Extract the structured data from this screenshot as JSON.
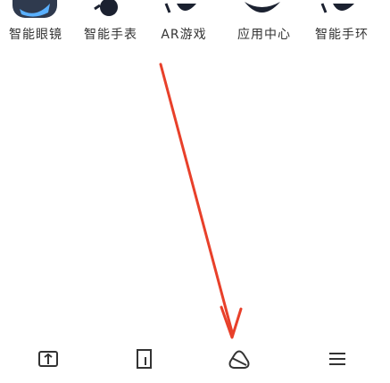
{
  "apps": [
    {
      "label": "智能眼镜",
      "icon": "wing-logo-icon"
    },
    {
      "label": "智能手表",
      "icon": "headset-icon"
    },
    {
      "label": "AR游戏",
      "icon": "ar-game-icon"
    },
    {
      "label": "应用中心",
      "icon": "bird-icon"
    },
    {
      "label": "智能手环",
      "icon": "band-icon"
    }
  ],
  "nav": [
    {
      "icon": "book-icon"
    },
    {
      "icon": "square-tab-icon"
    },
    {
      "icon": "cloud-sync-icon"
    },
    {
      "icon": "menu-icon"
    }
  ],
  "colors": {
    "annotation_arrow": "#e8402a",
    "label_text": "#333333",
    "nav_icon": "#333333"
  }
}
